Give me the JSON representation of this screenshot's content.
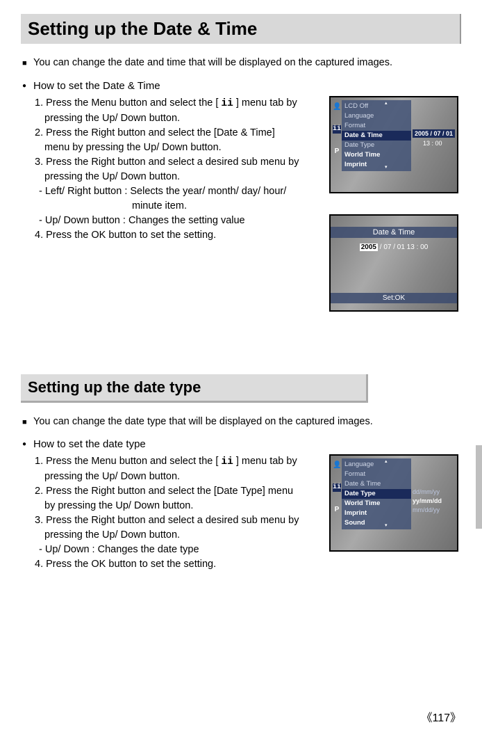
{
  "section1": {
    "title": "Setting up the Date & Time",
    "intro": "You can change the date and time that will be displayed on the captured images.",
    "howto_label": "How to set the Date & Time",
    "icon_text": "ii",
    "steps_l1": "1. Press the Menu button and select the [",
    "steps_l1b": "] menu tab by",
    "steps_l2": "pressing the Up/ Down button.",
    "steps_l3": "2. Press the Right button and select the [Date & Time]",
    "steps_l4": "menu by pressing the Up/ Down button.",
    "steps_l5": "3. Press the Right button and select a desired sub menu by",
    "steps_l6": "pressing the Up/ Down button.",
    "steps_l7": "- Left/ Right button : Selects the year/ month/ day/ hour/",
    "steps_l8": "minute item.",
    "steps_l9": "- Up/ Down button : Changes the setting value",
    "steps_l10": "4. Press the OK button to set the setting."
  },
  "lcd1": {
    "items": [
      "LCD Off",
      "Language",
      "Format",
      "Date & Time",
      "Date Type",
      "World Time",
      "Imprint"
    ],
    "value": "2005 / 07 / 01",
    "sub": "13 : 00"
  },
  "lcd2": {
    "title": "Date & Time",
    "year": "2005",
    "rest": "/ 07 / 01   13 : 00",
    "setok": "Set:OK"
  },
  "section2": {
    "title": "Setting up the date type",
    "intro": "You can change the date type that will be displayed on the captured images.",
    "howto_label": "How to set the date type",
    "icon_text": "ii",
    "steps_l1": "1. Press the Menu button and select the [",
    "steps_l1b": "] menu tab by",
    "steps_l2": "pressing the Up/ Down button.",
    "steps_l3": "2. Press the Right button and select the [Date Type] menu",
    "steps_l4": "by pressing the Up/ Down button.",
    "steps_l5": "3. Press the Right button and select a desired sub menu by",
    "steps_l6": "pressing the Up/ Down button.",
    "steps_l7": "- Up/ Down : Changes the date type",
    "steps_l8": "4. Press the OK button to set the setting."
  },
  "lcd3": {
    "items": [
      "Language",
      "Format",
      "Date & Time",
      "Date Type",
      "World Time",
      "Imprint",
      "Sound"
    ],
    "opts": [
      "dd/mm/yy",
      "yy/mm/dd",
      "mm/dd/yy"
    ]
  },
  "page_number": "《117》",
  "icons": {
    "person": "👤",
    "tools": "ii",
    "p": "P"
  }
}
